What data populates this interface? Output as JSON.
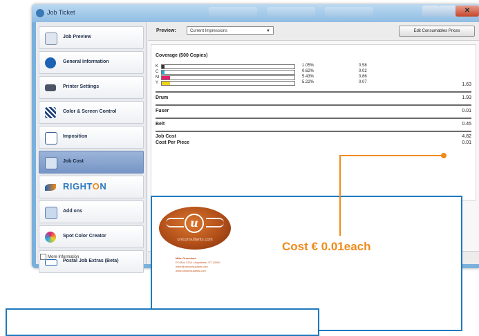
{
  "window": {
    "title": "Job Ticket",
    "close_glyph": "✕"
  },
  "sidebar": {
    "items": [
      {
        "label": "Job Preview",
        "icon": "magnifier-icon"
      },
      {
        "label": "General Information",
        "icon": "info-icon"
      },
      {
        "label": "Printer Settings",
        "icon": "printer-icon"
      },
      {
        "label": "Color & Screen Control",
        "icon": "color-screen-icon"
      },
      {
        "label": "Imposition",
        "icon": "imposition-icon"
      },
      {
        "label": "Job Cost",
        "icon": "calculator-icon",
        "active": true
      },
      {
        "label": "",
        "icon": "righton-icon"
      },
      {
        "label": "Add ons",
        "icon": "add-ons-icon"
      },
      {
        "label": "Spot Color Creator",
        "icon": "spot-color-icon"
      },
      {
        "label": "Postal Job Extras (Beta)",
        "icon": "postal-icon"
      }
    ],
    "righton_logo": {
      "part1": "RIGHT",
      "part2": "O",
      "part3": "N"
    },
    "more_info_label": "More Information"
  },
  "toolbar": {
    "preset_label": "Preview:",
    "preset_value": "Current Impressions",
    "edit_button": "Edit Consumables Prices"
  },
  "cost": {
    "heading": "Coverage (500 Copies)",
    "coverage": [
      {
        "letter": "K",
        "percent": "1.05%",
        "cost": "0.58",
        "fill": 0.02,
        "color": "#333333"
      },
      {
        "letter": "C",
        "percent": "0.62%",
        "cost": "0.02",
        "fill": 0.02,
        "color": "#2aa7df"
      },
      {
        "letter": "M",
        "percent": "5.43%",
        "cost": "0.86",
        "fill": 0.06,
        "color": "#e0206b"
      },
      {
        "letter": "Y",
        "percent": "5.22%",
        "cost": "0.07",
        "fill": 0.06,
        "color": "#f0d21c"
      }
    ],
    "coverage_total": "1.63",
    "drum_label": "Drum",
    "drum_value": "1.93",
    "fuser_label": "Fuser",
    "fuser_value": "0.01",
    "belt_label": "Belt",
    "belt_value": "0.45",
    "job_cost_label": "Job Cost",
    "job_cost_value": "4.82",
    "cost_per_piece_label": "Cost Per Piece",
    "cost_per_piece_value": "0.01"
  },
  "preview": {
    "logo_letter": "u",
    "logo_url": "uniconsultants.com",
    "address_lines": [
      "Mike Greenland",
      "PO Box 1234  •  Anywhere, ST 10000",
      "mike@uniconsultants.com",
      "www.uniconsultants.com"
    ]
  },
  "annotation": {
    "text": "Cost € 0.01each",
    "color": "#ef8a1a"
  }
}
